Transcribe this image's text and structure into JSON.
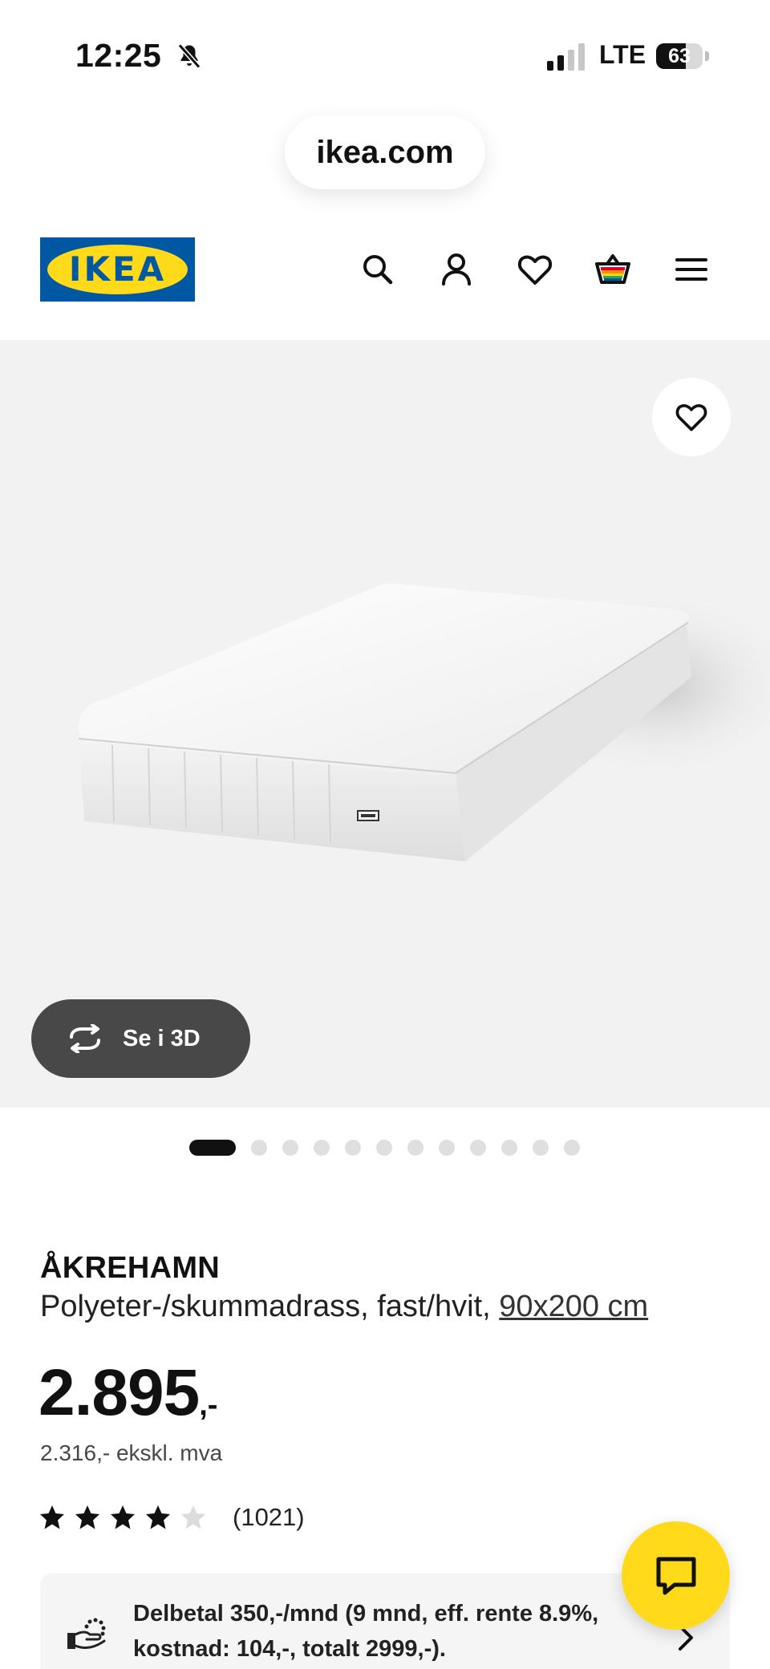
{
  "status_bar": {
    "time": "12:25",
    "network": "LTE",
    "battery_level": "63",
    "battery_fraction": 0.63,
    "icons": [
      "bell-slash-icon",
      "signal-icon",
      "battery-icon"
    ]
  },
  "browser": {
    "url": "ikea.com"
  },
  "header": {
    "logo_text": "IKEA",
    "logo_colors": {
      "blue": "#0058a3",
      "yellow": "#ffda1a"
    },
    "icons": [
      "search-icon",
      "account-icon",
      "heart-icon",
      "cart-icon",
      "menu-icon"
    ]
  },
  "hero": {
    "view_3d_label": "Se i 3D",
    "carousel_count": 12,
    "carousel_active_index": 0,
    "background_color": "#f2f2f2"
  },
  "product": {
    "name": "ÅKREHAMN",
    "description": "Polyeter-/skummadrass, fast/hvit, ",
    "size_link": "90x200 cm",
    "price": "2.895",
    "price_suffix": ",-",
    "price_ex_vat": "2.316,- ekskl. mva",
    "rating_value": 4,
    "rating_max": 5,
    "rating_count": "(1021)"
  },
  "installment": {
    "text": "Delbetal 350,-/mnd (9 mnd, eff. rente 8.9%, kostnad: 104,-, totalt 2999,-)."
  },
  "colors": {
    "accent_yellow": "#ffda1a",
    "text": "#111111",
    "pill_dark": "#484848"
  }
}
